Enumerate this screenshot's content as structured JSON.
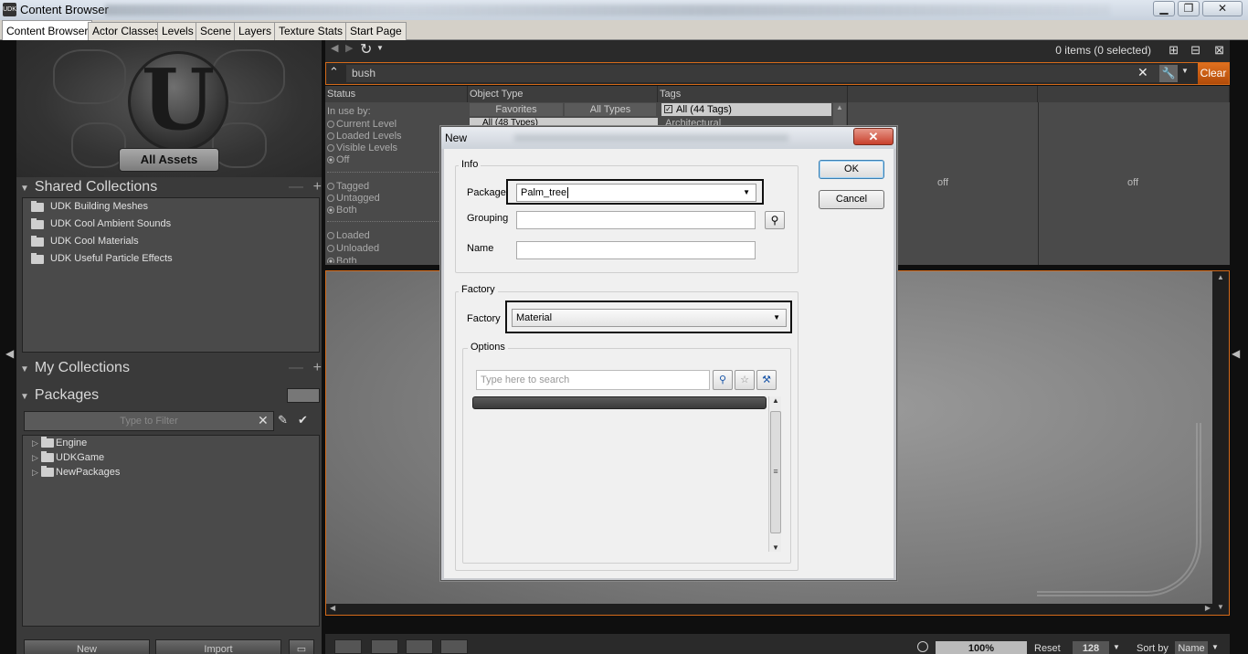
{
  "window": {
    "title": "Content Browser",
    "app_icon": "UDK",
    "minimize": "▁",
    "maximize": "❐",
    "close": "✕"
  },
  "tabs": [
    {
      "label": "Content Browser",
      "active": true
    },
    {
      "label": "Actor Classes"
    },
    {
      "label": "Levels"
    },
    {
      "label": "Scene"
    },
    {
      "label": "Layers"
    },
    {
      "label": "Texture Stats"
    },
    {
      "label": "Start Page"
    }
  ],
  "left": {
    "all_assets_button": "All Assets",
    "shared_collections": {
      "title": "Shared Collections",
      "items": [
        "UDK Building Meshes",
        "UDK Cool Ambient Sounds",
        "UDK Cool Materials",
        "UDK Useful Particle Effects"
      ]
    },
    "my_collections": {
      "title": "My Collections"
    },
    "packages": {
      "title": "Packages",
      "filter_placeholder": "Type to Filter",
      "tree": [
        "Engine",
        "UDKGame",
        "NewPackages"
      ]
    },
    "buttons": {
      "new": "New",
      "import": "Import"
    }
  },
  "browser": {
    "items_status": "0 items (0 selected)",
    "search_value": "bush",
    "clear_label": "Clear",
    "filters": {
      "status_header": "Status",
      "object_type_header": "Object Type",
      "tags_header": "Tags",
      "in_use_by": "In use by:",
      "status_options": [
        "Current Level",
        "Loaded Levels",
        "Visible Levels",
        "Off"
      ],
      "tag_options": [
        "Tagged",
        "Untagged",
        "Both"
      ],
      "load_options": [
        "Loaded",
        "Unloaded",
        "Both"
      ],
      "type_tabs": [
        "Favorites",
        "All Types"
      ],
      "all_types": "All (48 Types)",
      "all_tags": "All (44 Tags)",
      "tag_partial": "Architectural",
      "col4_value": "off",
      "col5_value": "off"
    },
    "zoom": "100%",
    "reset_label": "Reset",
    "thumb_size": "128",
    "sort_label": "Sort by",
    "sort_value": "Name"
  },
  "dialog": {
    "title": "New",
    "info_label": "Info",
    "package_label": "Package",
    "package_value": "Palm_tree",
    "grouping_label": "Grouping",
    "grouping_value": "",
    "name_label": "Name",
    "name_value": "",
    "factory_group_label": "Factory",
    "factory_label": "Factory",
    "factory_value": "Material",
    "options_label": "Options",
    "options_search_placeholder": "Type here to search",
    "ok_label": "OK",
    "cancel_label": "Cancel"
  },
  "colors": {
    "accent": "#d46a1a",
    "clear_button": "#c85a10",
    "panel": "#3a3a3a"
  }
}
